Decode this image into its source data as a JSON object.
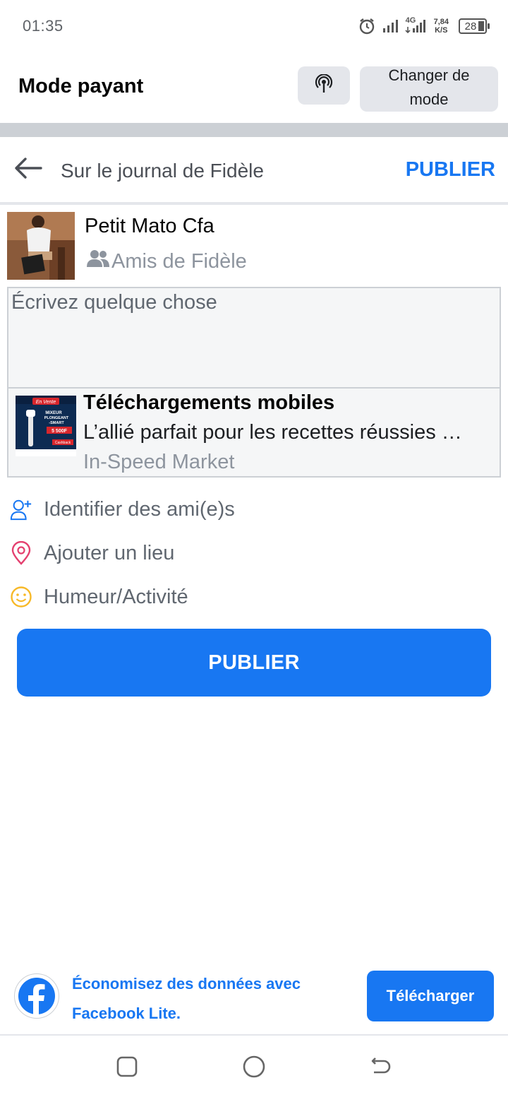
{
  "status_bar": {
    "time": "01:35",
    "network_type": "4G",
    "net_speed_value": "7,84",
    "net_speed_unit": "K/S",
    "battery": "28"
  },
  "mode_bar": {
    "title": "Mode payant",
    "change_mode_line1": "Changer de",
    "change_mode_line2": "mode"
  },
  "header": {
    "title": "Sur le journal de Fidèle",
    "publish_label": "PUBLIER"
  },
  "author": {
    "name": "Petit Mato Cfa",
    "audience": "Amis de Fidèle"
  },
  "composer": {
    "placeholder": "Écrivez quelque chose"
  },
  "link_preview": {
    "title": "Téléchargements mobiles",
    "description": "L’allié parfait pour les recettes réussies …",
    "source": "In-Speed Market",
    "thumb_badge": "En Vente",
    "thumb_line1": "MIXEUR",
    "thumb_line2": "PLONGEANT",
    "thumb_line3": "-SMART",
    "thumb_price": "5 500F",
    "thumb_cashback": "Cashback"
  },
  "options": [
    {
      "label": "Identifier des ami(e)s",
      "icon": "tag-friends-icon",
      "color": "#1877f2"
    },
    {
      "label": "Ajouter un lieu",
      "icon": "location-pin-icon",
      "color": "#e4406f"
    },
    {
      "label": "Humeur/Activité",
      "icon": "smiley-icon",
      "color": "#f7b928"
    }
  ],
  "publish_button": {
    "label": "PUBLIER"
  },
  "promo": {
    "text_line1": "Économisez des données avec",
    "text_line2": "Facebook Lite.",
    "button_label": "Télécharger"
  },
  "colors": {
    "accent": "#1877f2",
    "divider": "#ccd0d5"
  }
}
